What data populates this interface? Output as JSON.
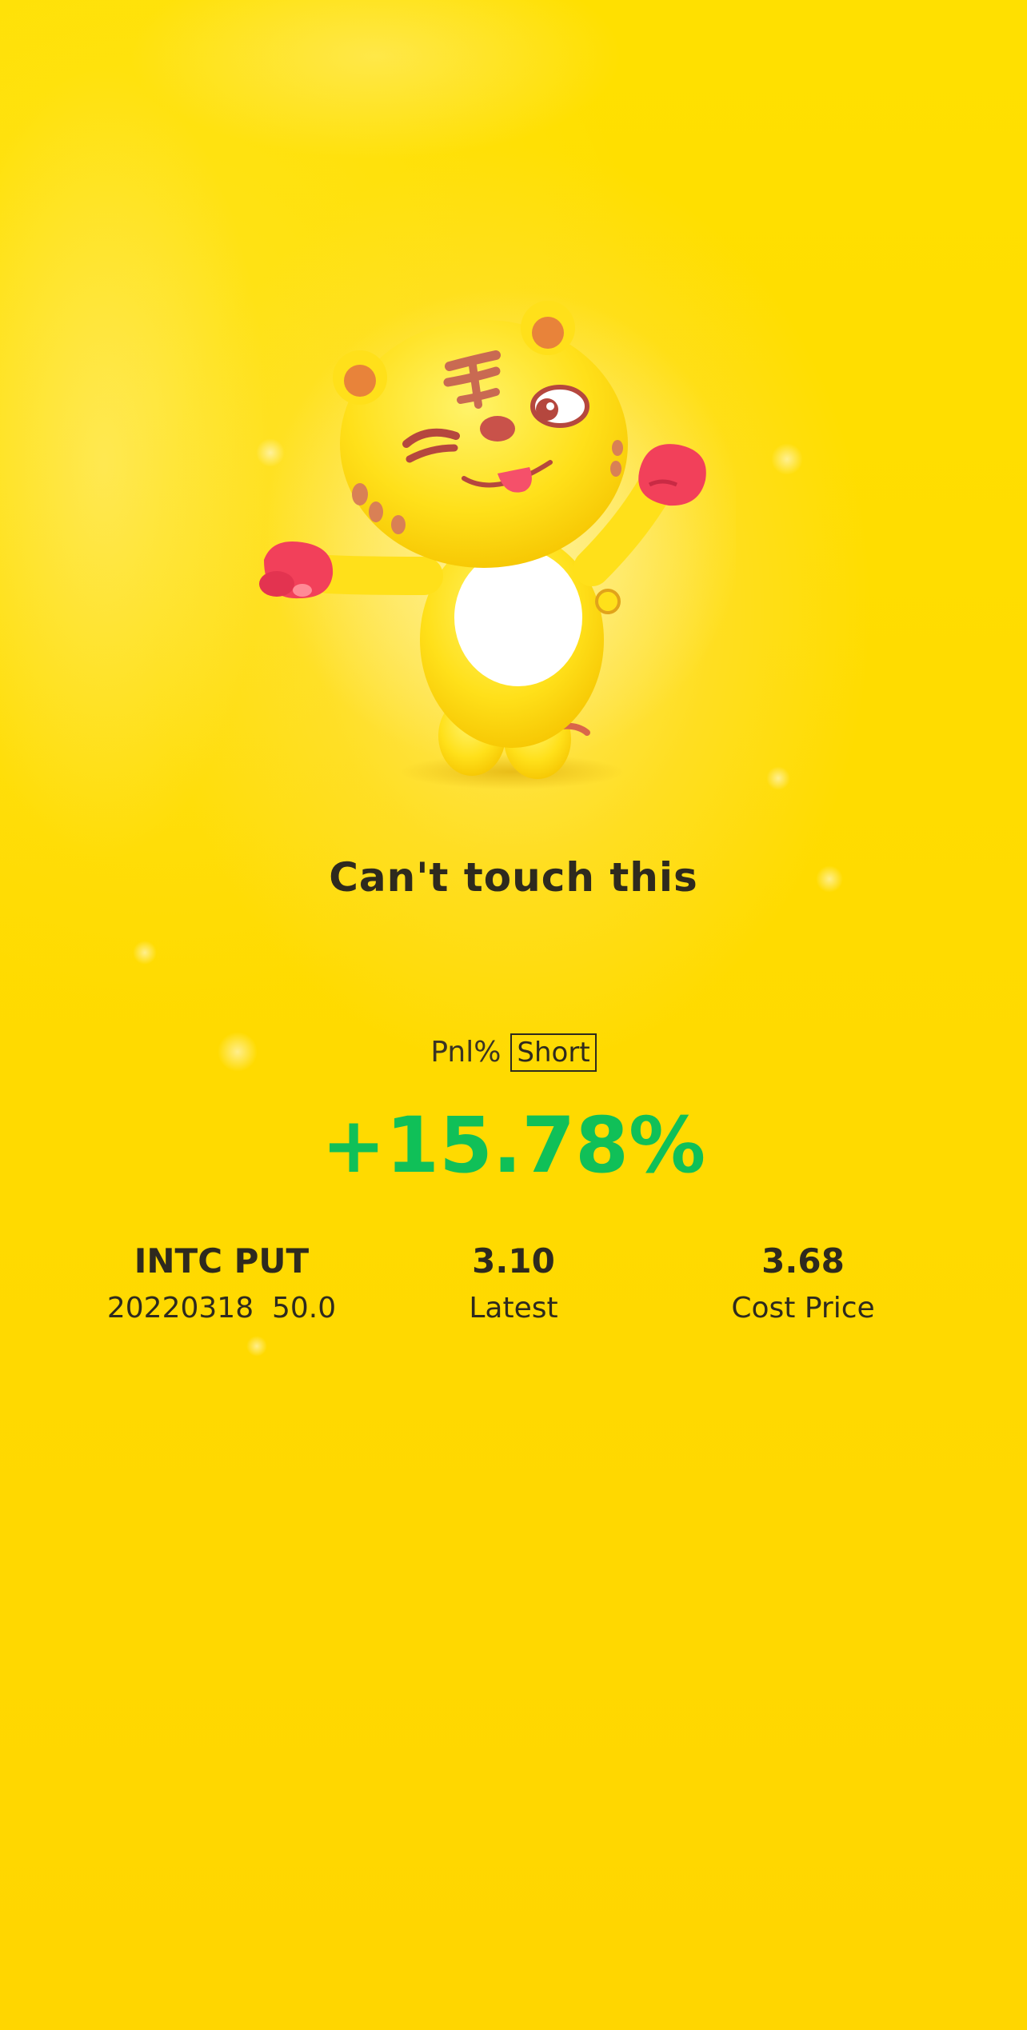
{
  "caption": "Can't touch this",
  "pnl": {
    "label": "Pnl%",
    "direction_tag": "Short",
    "value": "+15.78%",
    "value_color": "#10c058"
  },
  "stats": {
    "symbol": "INTC PUT",
    "contract": "20220318  50.0",
    "latest_value": "3.10",
    "latest_label": "Latest",
    "cost_value": "3.68",
    "cost_label": "Cost Price"
  },
  "mascot": {
    "icon": "tiger-mascot-icon"
  },
  "colors": {
    "background": "#ffdb00",
    "text": "#2e2a1e",
    "positive": "#10c058"
  }
}
